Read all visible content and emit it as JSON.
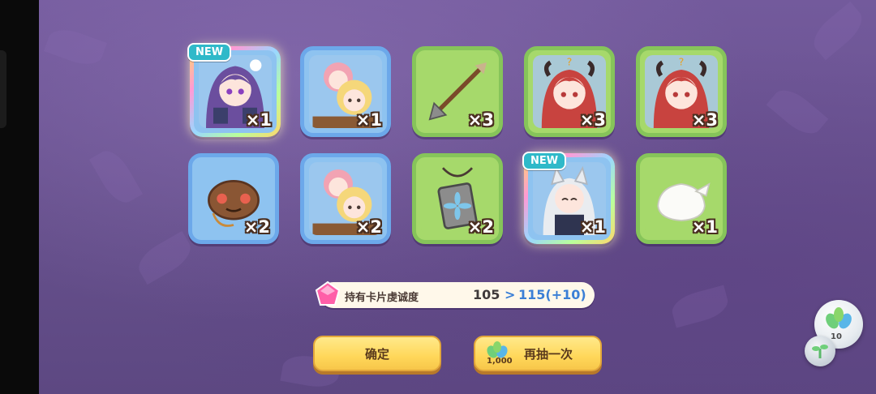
{
  "cards": [
    {
      "qty": "×1",
      "badge": "NEW",
      "kind": "character",
      "subject": "purple-hair-girl-portrait"
    },
    {
      "qty": "×1",
      "badge": "",
      "kind": "character",
      "subject": "twin-girls-portrait"
    },
    {
      "qty": "×3",
      "badge": "",
      "kind": "item",
      "subject": "arrow"
    },
    {
      "qty": "×3",
      "badge": "",
      "kind": "character",
      "subject": "red-hair-horned-girl-portrait"
    },
    {
      "qty": "×3",
      "badge": "",
      "kind": "character",
      "subject": "red-hair-horned-girl-portrait"
    },
    {
      "qty": "×2",
      "badge": "",
      "kind": "item",
      "subject": "cookie-pouch"
    },
    {
      "qty": "×2",
      "badge": "",
      "kind": "character",
      "subject": "twin-girls-portrait"
    },
    {
      "qty": "×2",
      "badge": "",
      "kind": "item",
      "subject": "stone-pendant"
    },
    {
      "qty": "×1",
      "badge": "NEW",
      "kind": "character",
      "subject": "white-hair-wolf-girl-portrait"
    },
    {
      "qty": "×1",
      "badge": "",
      "kind": "item",
      "subject": "white-cloth-bundle"
    }
  ],
  "affinity": {
    "label": "持有卡片虔诚度",
    "before": "105",
    "arrow": ">",
    "after": "115(+10)"
  },
  "buttons": {
    "confirm": "确定",
    "redraw": "再抽一次",
    "redraw_cost": "1,000"
  },
  "bubble": {
    "count": "10"
  },
  "colors": {
    "accent_blue": "#3b7fd6",
    "button_yellow": "#ffd75a",
    "card_green": "#a6d96b",
    "card_blue": "#8ec3f0",
    "new_badge": "#2fb9c9"
  }
}
